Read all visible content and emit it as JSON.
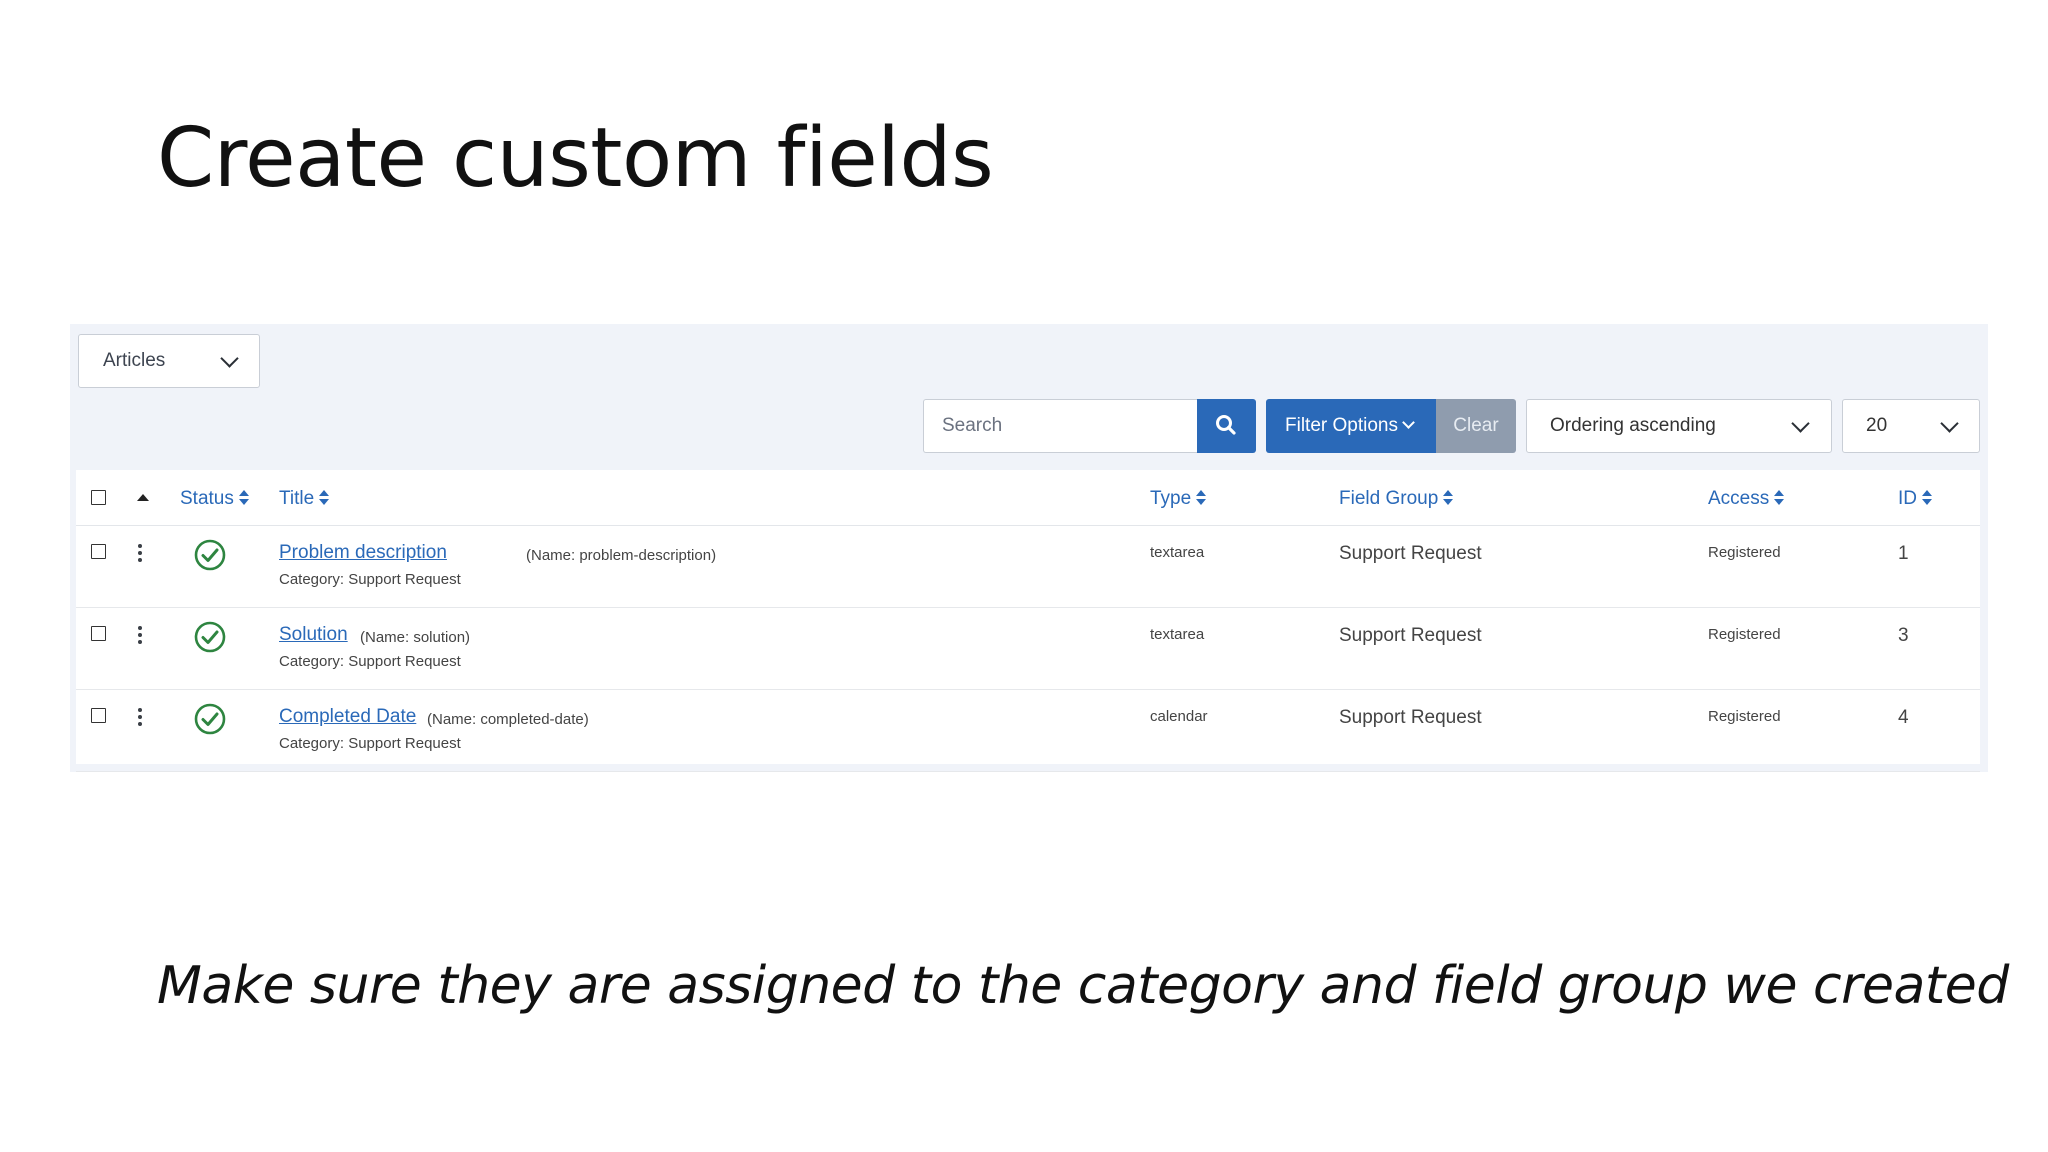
{
  "slide": {
    "title": "Create custom fields",
    "caption": "Make sure they are assigned to the category and field group we created"
  },
  "toolbar": {
    "context_select": "Articles",
    "search_placeholder": "Search",
    "filter_label": "Filter Options",
    "clear_label": "Clear",
    "ordering_select": "Ordering ascending",
    "limit_select": "20"
  },
  "table": {
    "headers": {
      "status": "Status",
      "title": "Title",
      "type": "Type",
      "field_group": "Field Group",
      "access": "Access",
      "id": "ID"
    },
    "rows": [
      {
        "title": "Problem description",
        "name_note": "(Name: problem-description)",
        "category": "Category: Support Request",
        "type": "textarea",
        "field_group": "Support Request",
        "access": "Registered",
        "id": "1",
        "published": true
      },
      {
        "title": "Solution",
        "name_note": "(Name: solution)",
        "category": "Category: Support Request",
        "type": "textarea",
        "field_group": "Support Request",
        "access": "Registered",
        "id": "3",
        "published": true
      },
      {
        "title": "Completed Date",
        "name_note": "(Name: completed-date)",
        "category": "Category: Support Request",
        "type": "calendar",
        "field_group": "Support Request",
        "access": "Registered",
        "id": "4",
        "published": true
      }
    ]
  },
  "colors": {
    "primary": "#2a69b8",
    "clear_button": "#8f9cae",
    "published_green": "#2e8540",
    "panel_background": "#f0f3f9"
  },
  "icons": {
    "search": "search-icon",
    "status": "check-circle-icon",
    "row_actions": "kebab-icon",
    "sort": "sort-icon"
  }
}
